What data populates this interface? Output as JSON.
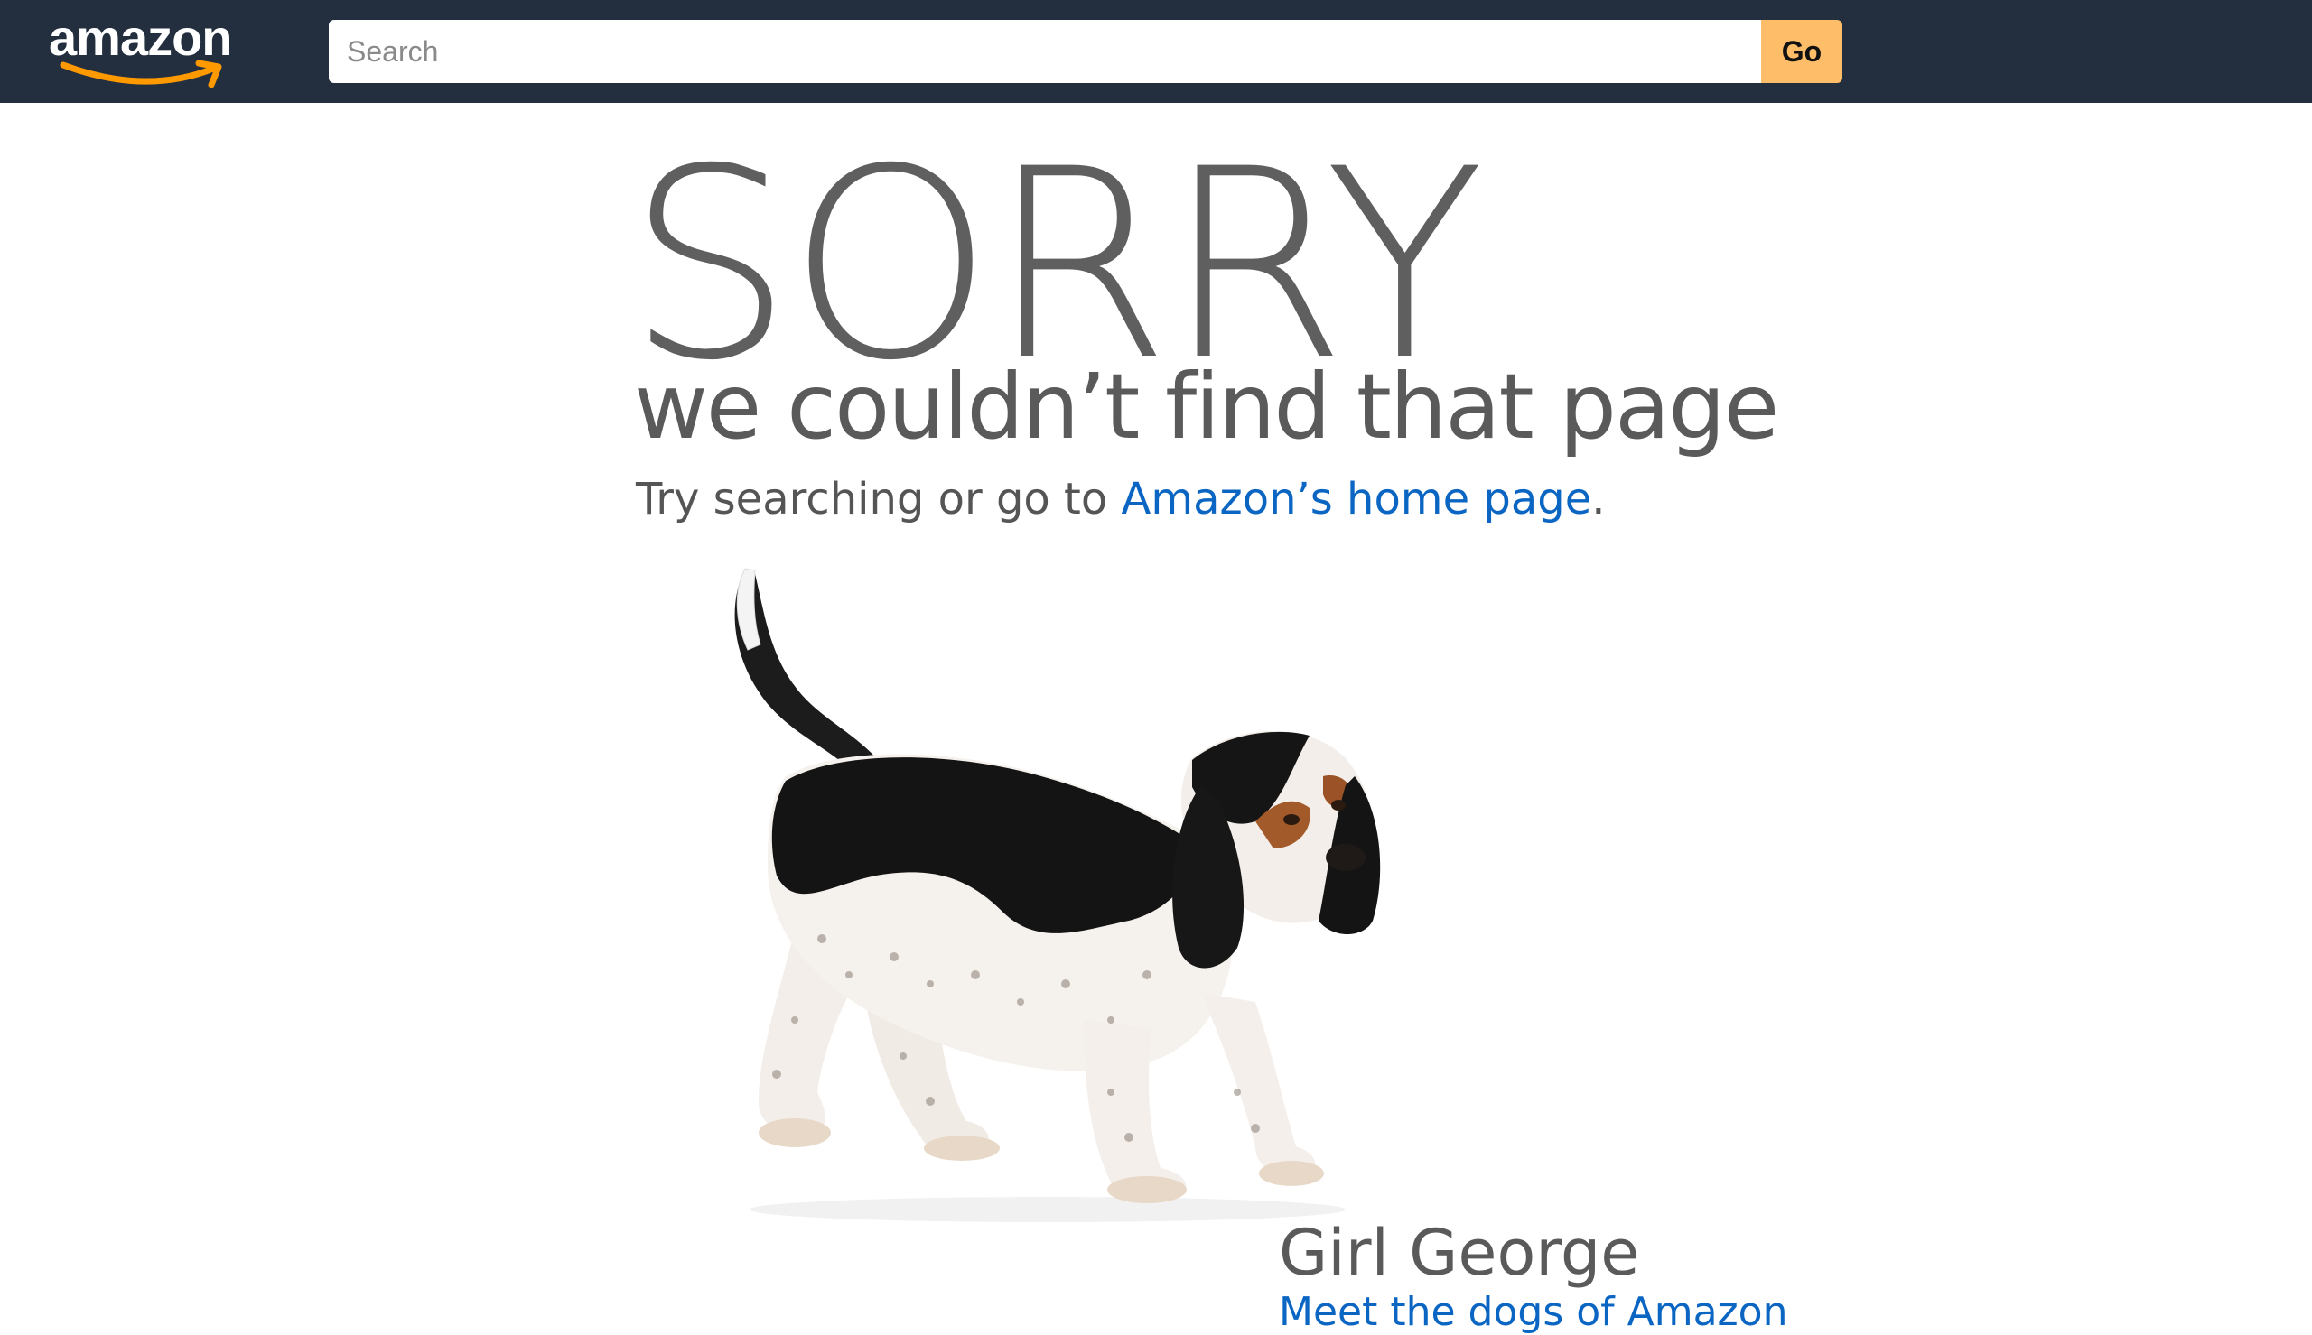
{
  "header": {
    "logo_text": "amazon",
    "background_color": "#232f3e",
    "search": {
      "placeholder": "Search",
      "value": ""
    },
    "go_label": "Go",
    "go_button_color": "#febd69"
  },
  "main": {
    "headline": "SORRY",
    "subtitle": "we couldn’t find that page",
    "hint_prefix": "Try searching or go to ",
    "hint_link": "Amazon’s home page",
    "hint_suffix": ".",
    "link_color": "#0a66c2",
    "dog": {
      "name": "Girl George",
      "link_text": "Meet the dogs of Amazon"
    }
  }
}
